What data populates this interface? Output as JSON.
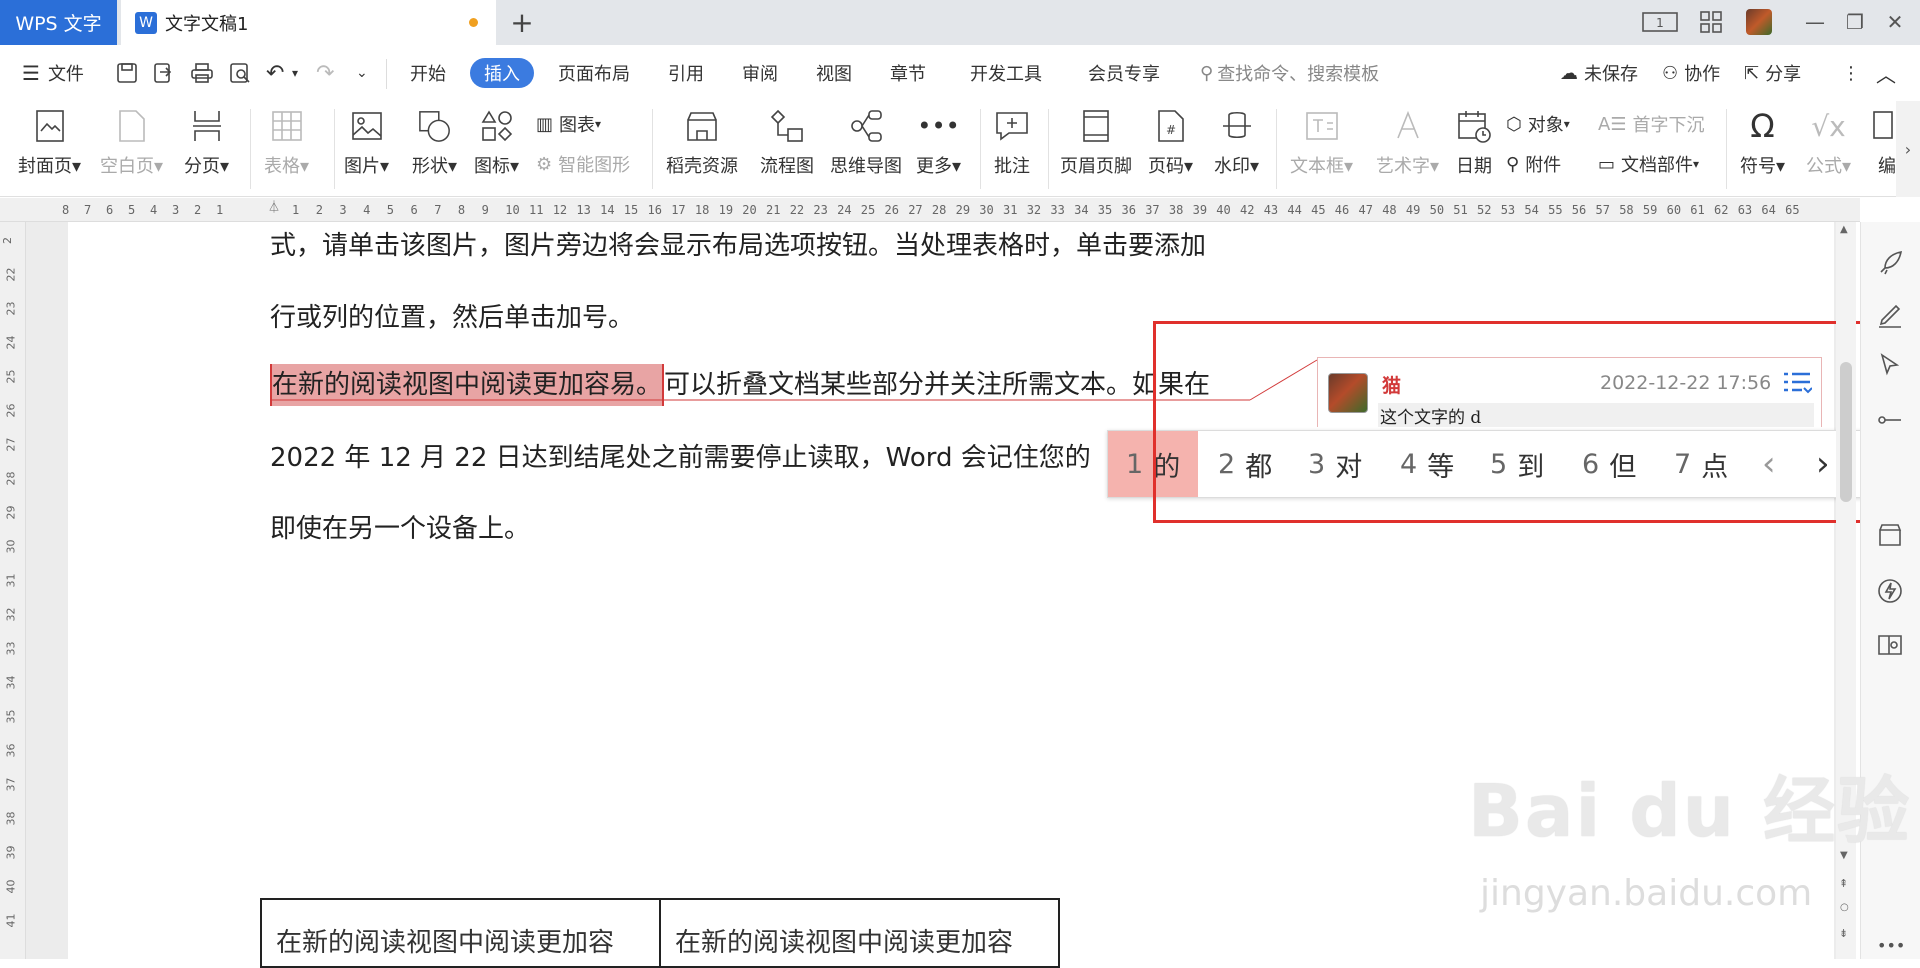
{
  "tabbar": {
    "app_tab": "WPS 文字",
    "doc_tab": "文字文稿1",
    "new_tab": "+",
    "win_badge": "1"
  },
  "menubar": {
    "file": "文件",
    "tabs": [
      "开始",
      "插入",
      "页面布局",
      "引用",
      "审阅",
      "视图",
      "章节",
      "开发工具",
      "会员专享"
    ],
    "active_tab": "插入",
    "search_placeholder": "查找命令、搜索模板",
    "unsaved": "未保存",
    "collab": "协作",
    "share": "分享"
  },
  "ribbon": {
    "cover": "封面页",
    "blank": "空白页",
    "pagebreak": "分页",
    "table": "表格",
    "picture": "图片",
    "shape": "形状",
    "icon": "图标",
    "chart": "图表",
    "smart": "智能图形",
    "daoke": "稻壳资源",
    "flow": "流程图",
    "mind": "思维导图",
    "more": "更多",
    "comment": "批注",
    "header_footer": "页眉页脚",
    "pageno": "页码",
    "watermark": "水印",
    "textbox": "文本框",
    "wordart": "艺术字",
    "date": "日期",
    "object": "对象",
    "attach": "附件",
    "dropcap": "首字下沉",
    "docpart": "文档部件",
    "symbol": "符号",
    "formula": "公式",
    "edit": "编"
  },
  "ruler": {
    "h_left": [
      "8",
      "7",
      "6",
      "5",
      "4",
      "3",
      "2",
      "1"
    ],
    "h_right": [
      "1",
      "2",
      "3",
      "4",
      "5",
      "6",
      "7",
      "8",
      "9",
      "10",
      "11",
      "12",
      "13",
      "14",
      "15",
      "16",
      "17",
      "18",
      "19",
      "20",
      "21",
      "22",
      "23",
      "24",
      "25",
      "26",
      "27",
      "28",
      "29",
      "30",
      "31",
      "32",
      "33",
      "34",
      "35",
      "36",
      "37",
      "38",
      "39",
      "40",
      "42",
      "43",
      "44",
      "45",
      "46",
      "47",
      "48",
      "49",
      "50",
      "51",
      "52",
      "53",
      "54",
      "55",
      "56",
      "57",
      "58",
      "59",
      "60",
      "61",
      "62",
      "63",
      "64",
      "65"
    ],
    "v": [
      "2",
      "22",
      "23",
      "24",
      "25",
      "26",
      "27",
      "28",
      "29",
      "30",
      "31",
      "32",
      "33",
      "34",
      "35",
      "36",
      "37",
      "38",
      "39",
      "40",
      "41"
    ]
  },
  "document": {
    "line1": "式，请单击该图片，图片旁边将会显示布局选项按钮。当处理表格时，单击要添加",
    "line2": "行或列的位置，然后单击加号。",
    "line3_highlight": "在新的阅读视图中阅读更加容易。",
    "line3_rest": "可以折叠文档某些部分并关注所需文本。如果在",
    "line4": "2022 年 12 月 22 日达到结尾处之前需要停止读取，Word  会记住您的",
    "line5": "即使在另一个设备上。",
    "table_cells": [
      "在新的阅读视图中阅读更加容",
      "在新的阅读视图中阅读更加容"
    ]
  },
  "comment": {
    "author": "猫",
    "time": "2022-12-22 17:56",
    "text": "这个文字的 d"
  },
  "ime": {
    "candidates": [
      {
        "n": "1",
        "w": "的"
      },
      {
        "n": "2",
        "w": "都"
      },
      {
        "n": "3",
        "w": "对"
      },
      {
        "n": "4",
        "w": "等"
      },
      {
        "n": "5",
        "w": "到"
      },
      {
        "n": "6",
        "w": "但"
      },
      {
        "n": "7",
        "w": "点"
      }
    ],
    "prev": "‹",
    "next": "›",
    "emoji": "☺"
  },
  "watermark": {
    "main": "Bai du 经验",
    "sub": "jingyan.baidu.com"
  },
  "colors": {
    "accent": "#3b7be0",
    "wps_blue": "#2b6fd8",
    "highlight": "#e8a4a4",
    "ime_selected": "#f5b3ae",
    "annotation_red": "#e0302c",
    "author_red": "#d23a3a"
  }
}
